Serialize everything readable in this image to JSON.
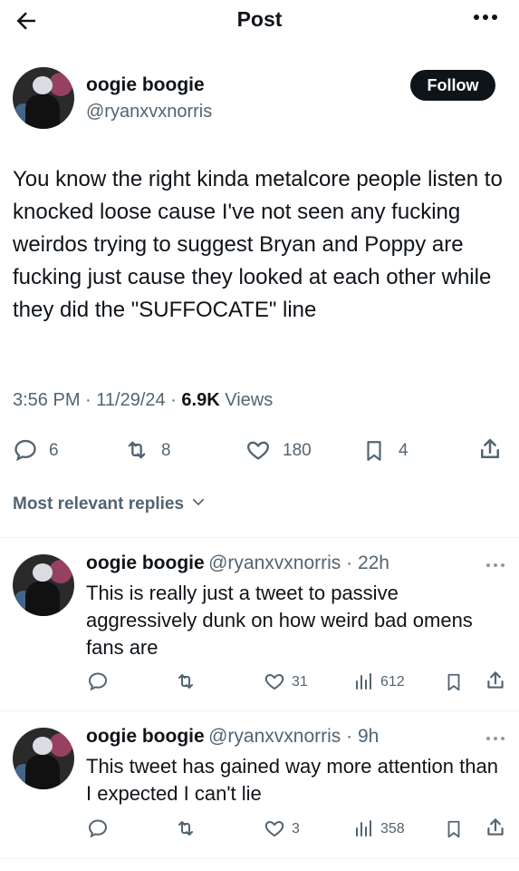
{
  "header": {
    "title": "Post"
  },
  "post": {
    "author_name": "oogie boogie",
    "author_handle": "@ryanxvxnorris",
    "follow_label": "Follow",
    "text": "You know the right kinda metalcore people listen to knocked loose cause I've not seen any fucking weirdos trying to suggest Bryan and Poppy are fucking just cause they looked at each other while they did the \"SUFFOCATE\" line",
    "time": "3:56 PM · 11/29/24 · ",
    "views_count": "6.9K",
    "views_label": " Views",
    "replies": "6",
    "reposts": "8",
    "likes": "180",
    "bookmarks": "4"
  },
  "replies_section": {
    "label": "Most relevant replies"
  },
  "replies": [
    {
      "author_name": "oogie boogie",
      "author_handle": "@ryanxvxnorris · 22h",
      "text": "This is really just a tweet to passive aggressively dunk on how weird bad omens fans are",
      "likes": "31",
      "views": "612"
    },
    {
      "author_name": "oogie boogie",
      "author_handle": "@ryanxvxnorris · 9h",
      "text": "This tweet has gained way more attention than I expected I can't lie",
      "likes": "3",
      "views": "358"
    }
  ]
}
